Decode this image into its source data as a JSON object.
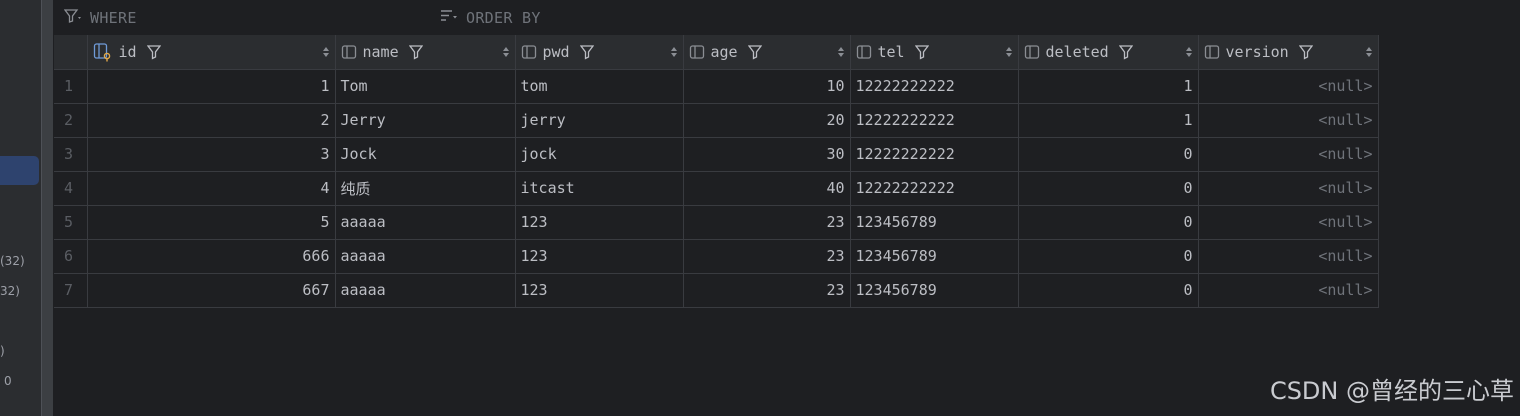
{
  "side": {
    "text1": "(32)",
    "text2": "32)",
    "text3": ")",
    "text4": "0"
  },
  "filter": {
    "where_label": "WHERE",
    "orderby_label": "ORDER BY"
  },
  "columns": [
    {
      "label": "id",
      "icon": "key-column-icon"
    },
    {
      "label": "name",
      "icon": "column-icon"
    },
    {
      "label": "pwd",
      "icon": "column-icon"
    },
    {
      "label": "age",
      "icon": "column-icon"
    },
    {
      "label": "tel",
      "icon": "column-icon"
    },
    {
      "label": "deleted",
      "icon": "column-icon"
    },
    {
      "label": "version",
      "icon": "column-icon"
    }
  ],
  "rows": [
    {
      "n": "1",
      "id": "1",
      "name": "Tom",
      "pwd": "tom",
      "age": "10",
      "tel": "12222222222",
      "deleted": "1",
      "version": "<null>"
    },
    {
      "n": "2",
      "id": "2",
      "name": "Jerry",
      "pwd": "jerry",
      "age": "20",
      "tel": "12222222222",
      "deleted": "1",
      "version": "<null>"
    },
    {
      "n": "3",
      "id": "3",
      "name": "Jock",
      "pwd": "jock",
      "age": "30",
      "tel": "12222222222",
      "deleted": "0",
      "version": "<null>"
    },
    {
      "n": "4",
      "id": "4",
      "name": "纯质",
      "pwd": "itcast",
      "age": "40",
      "tel": "12222222222",
      "deleted": "0",
      "version": "<null>"
    },
    {
      "n": "5",
      "id": "5",
      "name": "aaaaa",
      "pwd": "123",
      "age": "23",
      "tel": "123456789",
      "deleted": "0",
      "version": "<null>"
    },
    {
      "n": "6",
      "id": "666",
      "name": "aaaaa",
      "pwd": "123",
      "age": "23",
      "tel": "123456789",
      "deleted": "0",
      "version": "<null>"
    },
    {
      "n": "7",
      "id": "667",
      "name": "aaaaa",
      "pwd": "123",
      "age": "23",
      "tel": "123456789",
      "deleted": "0",
      "version": "<null>"
    }
  ],
  "watermark": "CSDN @曾经的三心草",
  "colors": {
    "background": "#1e1f22",
    "header": "#2b2d30",
    "grid_line": "#393b40",
    "key_icon": "#e0a84a",
    "selection": "#2e436e"
  }
}
